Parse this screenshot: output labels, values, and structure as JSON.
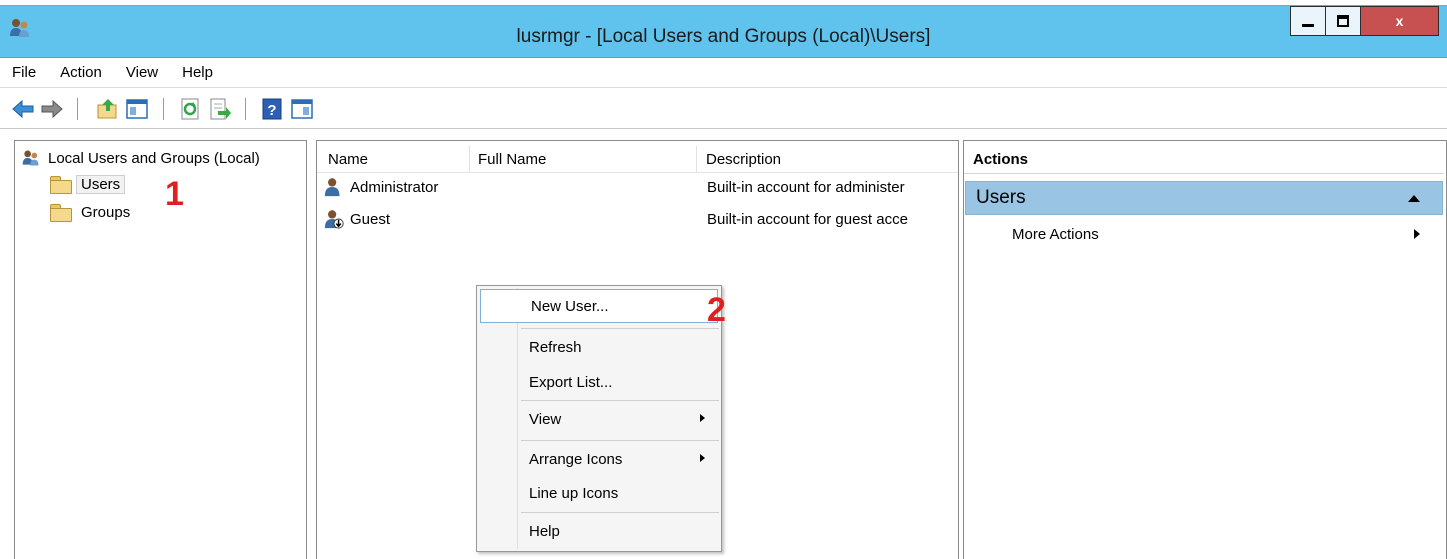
{
  "window": {
    "title": "lusrmgr - [Local Users and Groups (Local)\\Users]",
    "close_glyph": "x"
  },
  "menubar": [
    "File",
    "Action",
    "View",
    "Help"
  ],
  "tree": {
    "root": "Local Users and Groups (Local)",
    "items": [
      "Users",
      "Groups"
    ]
  },
  "list": {
    "columns": [
      "Name",
      "Full Name",
      "Description"
    ],
    "rows": [
      {
        "name": "Administrator",
        "full_name": "",
        "description": "Built-in account for administer"
      },
      {
        "name": "Guest",
        "full_name": "",
        "description": "Built-in account for guest acce"
      }
    ]
  },
  "context_menu": {
    "items": [
      {
        "label": "New User...",
        "highlighted": true,
        "submenu": false
      },
      {
        "label": "Refresh",
        "highlighted": false,
        "submenu": false
      },
      {
        "label": "Export List...",
        "highlighted": false,
        "submenu": false
      },
      {
        "label": "View",
        "highlighted": false,
        "submenu": true
      },
      {
        "label": "Arrange Icons",
        "highlighted": false,
        "submenu": true
      },
      {
        "label": "Line up Icons",
        "highlighted": false,
        "submenu": false
      },
      {
        "label": "Help",
        "highlighted": false,
        "submenu": false
      }
    ]
  },
  "actions": {
    "header": "Actions",
    "section": "Users",
    "items": [
      "More Actions"
    ]
  },
  "annotations": [
    "1",
    "2"
  ],
  "colors": {
    "titlebar": "#5fc3ed",
    "close_button": "#c75050",
    "actions_section": "#99c4e3",
    "annotation": "#e02020",
    "menu_highlight_border": "#7fb0db"
  },
  "icons": {
    "app": "users-group-icon",
    "toolbar": [
      "back-arrow-icon",
      "forward-arrow-icon",
      "up-folder-icon",
      "show-hide-console-tree-icon",
      "refresh-icon",
      "export-list-icon",
      "help-icon",
      "show-hide-action-pane-icon"
    ]
  }
}
